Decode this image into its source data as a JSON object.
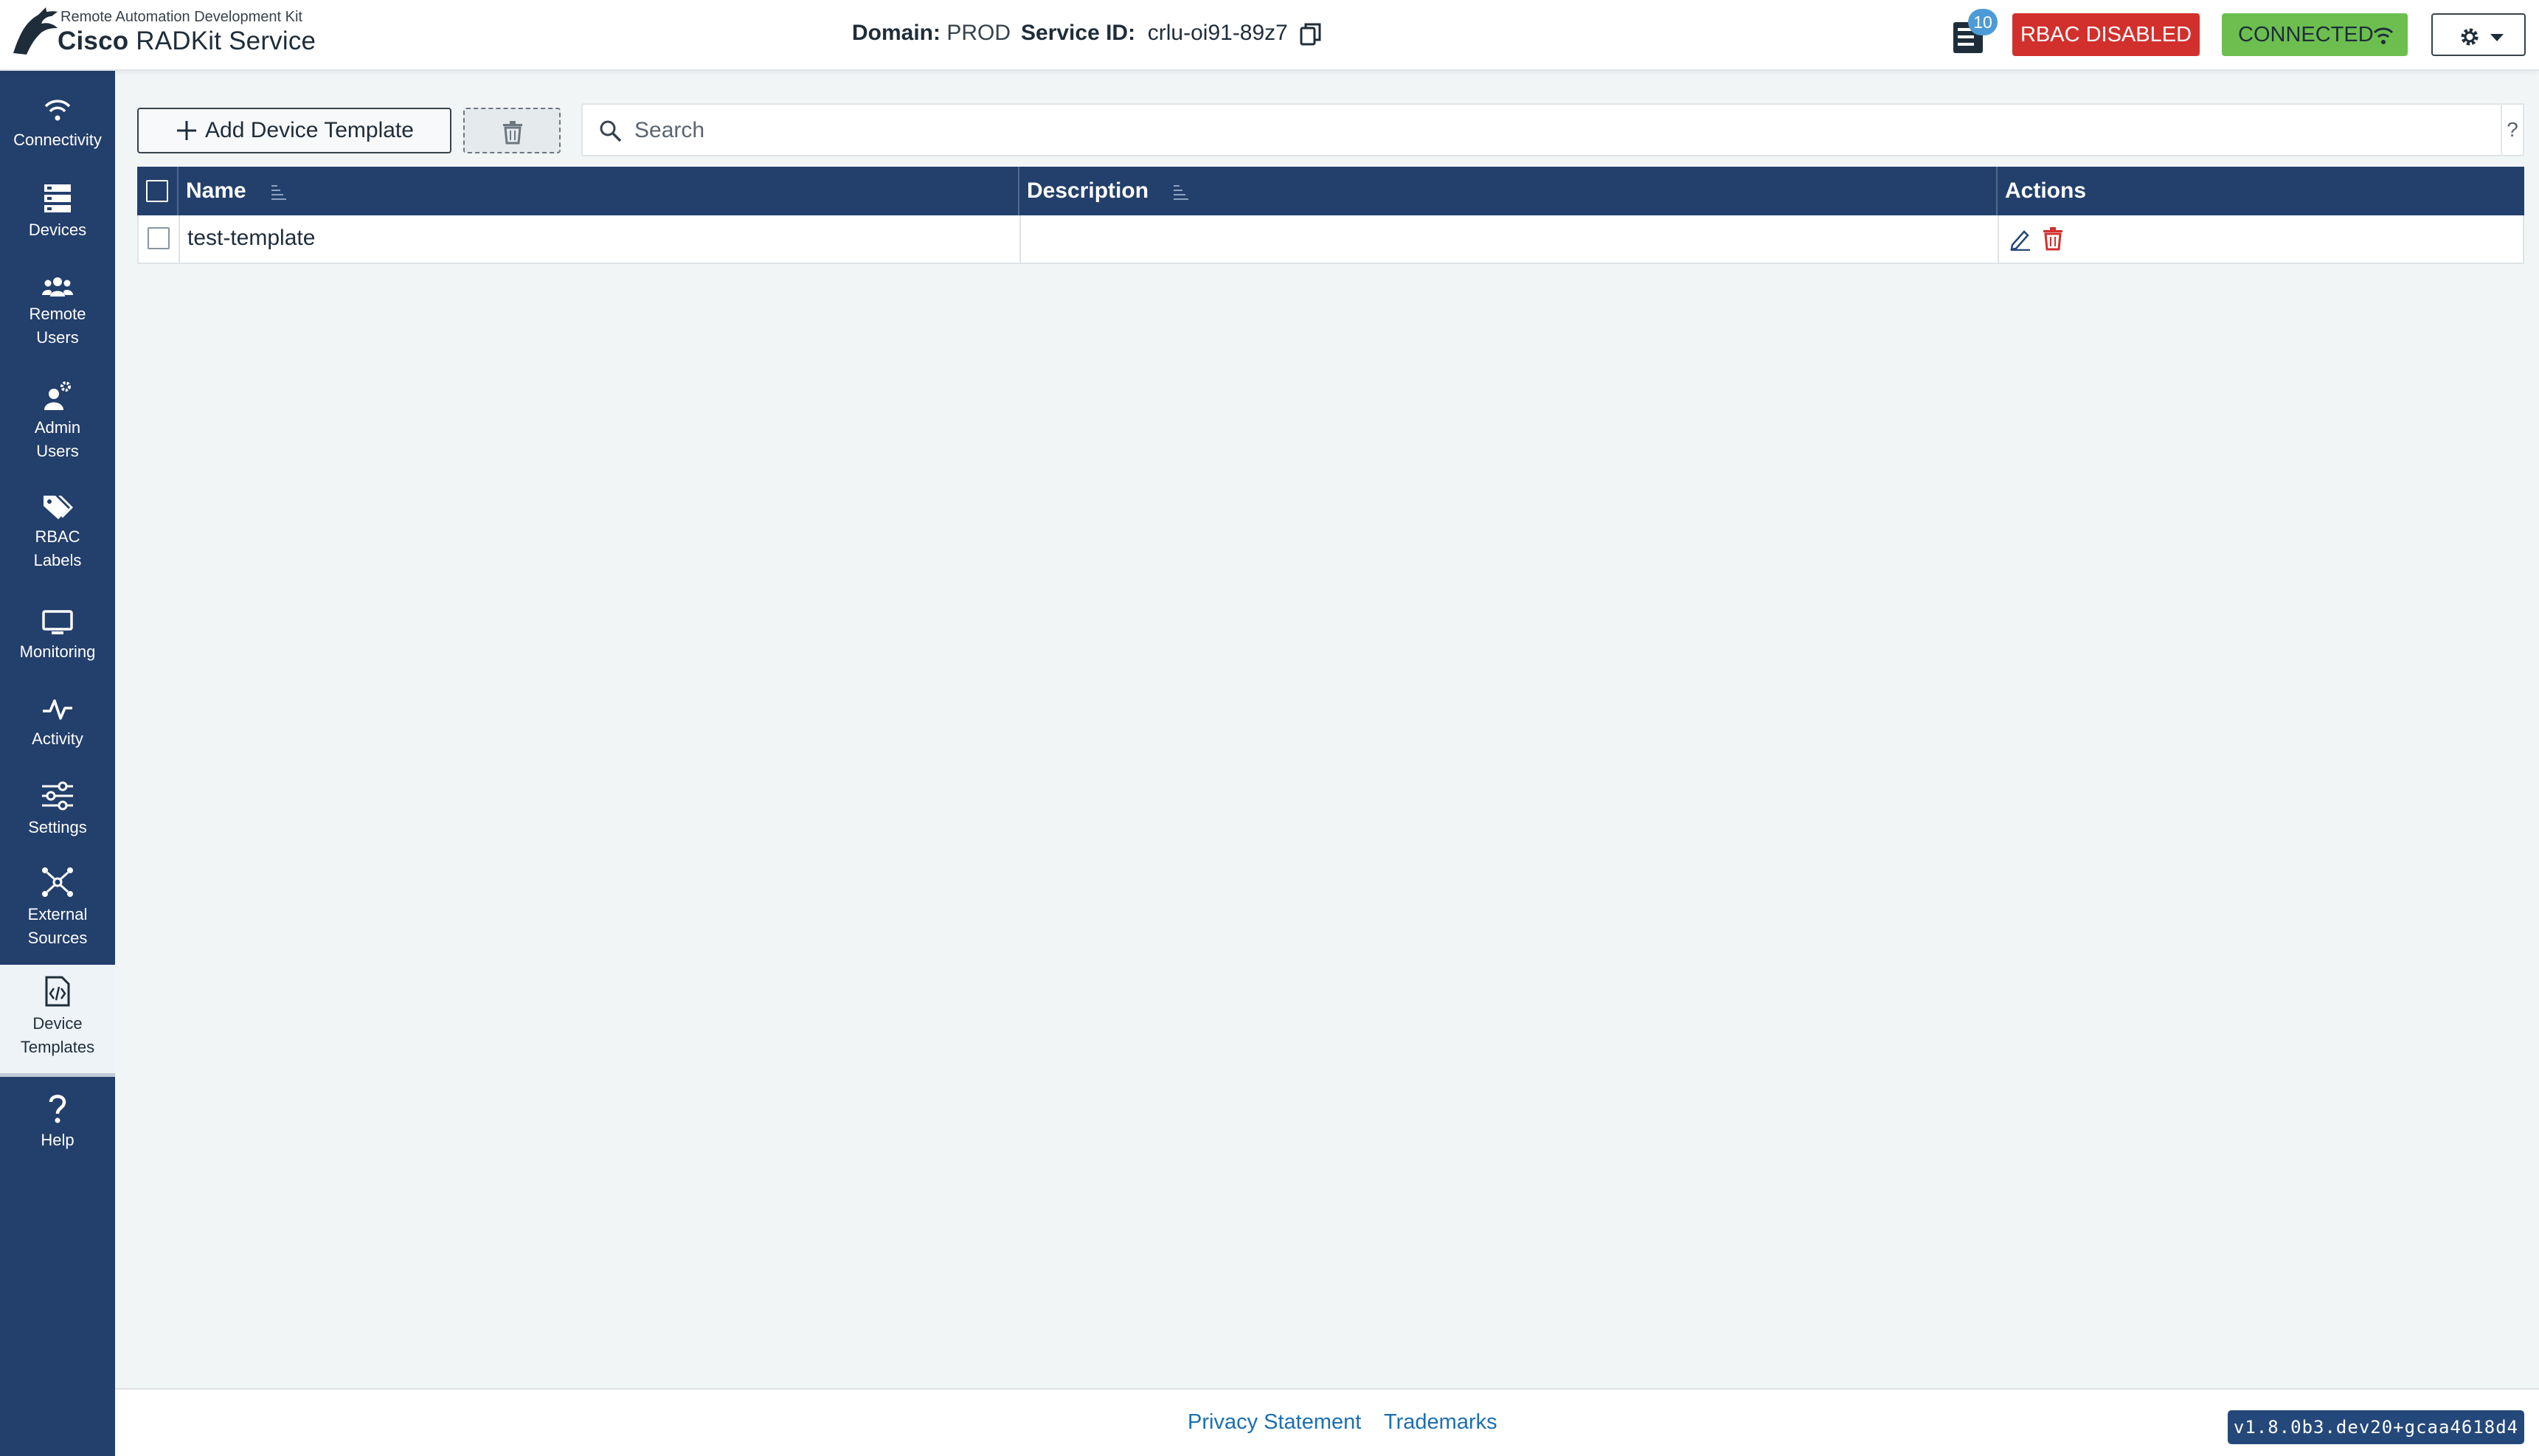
{
  "header": {
    "brand_subtitle": "Remote Automation Development Kit",
    "brand_bold": "Cisco",
    "brand_rest": "RADKit Service",
    "domain_label": "Domain:",
    "domain_value": "PROD",
    "service_label": "Service ID:",
    "service_value": "crlu-oi91-89z7",
    "jobs_badge": "10",
    "rbac_label": "RBAC DISABLED",
    "connection_label": "CONNECTED"
  },
  "sidebar": {
    "items": [
      {
        "label": "Connectivity",
        "icon": "wifi-icon"
      },
      {
        "label": "Devices",
        "icon": "server-icon"
      },
      {
        "label1": "Remote",
        "label2": "Users",
        "icon": "users-icon"
      },
      {
        "label1": "Admin",
        "label2": "Users",
        "icon": "admin-user-icon"
      },
      {
        "label1": "RBAC",
        "label2": "Labels",
        "icon": "tags-icon"
      },
      {
        "label": "Monitoring",
        "icon": "monitor-icon"
      },
      {
        "label": "Activity",
        "icon": "activity-icon"
      },
      {
        "label": "Settings",
        "icon": "sliders-icon"
      },
      {
        "label1": "External",
        "label2": "Sources",
        "icon": "network-icon"
      },
      {
        "label1": "Device",
        "label2": "Templates",
        "icon": "code-file-icon"
      },
      {
        "label": "Help",
        "icon": "help-icon"
      }
    ],
    "active": "Device Templates"
  },
  "toolbar": {
    "add_label": "Add Device Template",
    "search_placeholder": "Search",
    "search_help": "?"
  },
  "table": {
    "columns": [
      "Name",
      "Description",
      "Actions"
    ],
    "rows": [
      {
        "name": "test-template",
        "description": ""
      }
    ]
  },
  "footer": {
    "privacy": "Privacy Statement",
    "trademarks": "Trademarks",
    "version": "v1.8.0b3.dev20+gcaa4618d4"
  },
  "colors": {
    "sidebar_bg": "#233f6b",
    "rbac_red": "#d2302c",
    "connected_green": "#6cbf4f",
    "link_blue": "#1b6fb0"
  }
}
